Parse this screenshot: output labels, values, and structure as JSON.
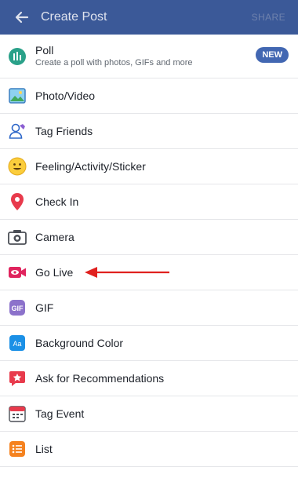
{
  "header": {
    "title": "Create Post",
    "share_label": "SHARE",
    "back_icon": "arrow-left-icon",
    "bg_color": "#3b5998"
  },
  "poll": {
    "title": "Poll",
    "subtitle": "Create a poll with photos, GIFs and more",
    "badge": "NEW",
    "icon": "poll-icon"
  },
  "items": [
    {
      "label": "Photo/Video",
      "icon": "photo-icon"
    },
    {
      "label": "Tag Friends",
      "icon": "tag-friends-icon"
    },
    {
      "label": "Feeling/Activity/Sticker",
      "icon": "smiley-icon"
    },
    {
      "label": "Check In",
      "icon": "location-pin-icon"
    },
    {
      "label": "Camera",
      "icon": "camera-icon"
    },
    {
      "label": "Go Live",
      "icon": "live-video-icon"
    },
    {
      "label": "GIF",
      "icon": "gif-icon"
    },
    {
      "label": "Background Color",
      "icon": "background-color-icon"
    },
    {
      "label": "Ask for Recommendations",
      "icon": "recommendation-icon"
    },
    {
      "label": "Tag Event",
      "icon": "calendar-icon"
    },
    {
      "label": "List",
      "icon": "list-icon"
    }
  ],
  "annotation": {
    "color": "#e0211f",
    "target": "Go Live"
  }
}
